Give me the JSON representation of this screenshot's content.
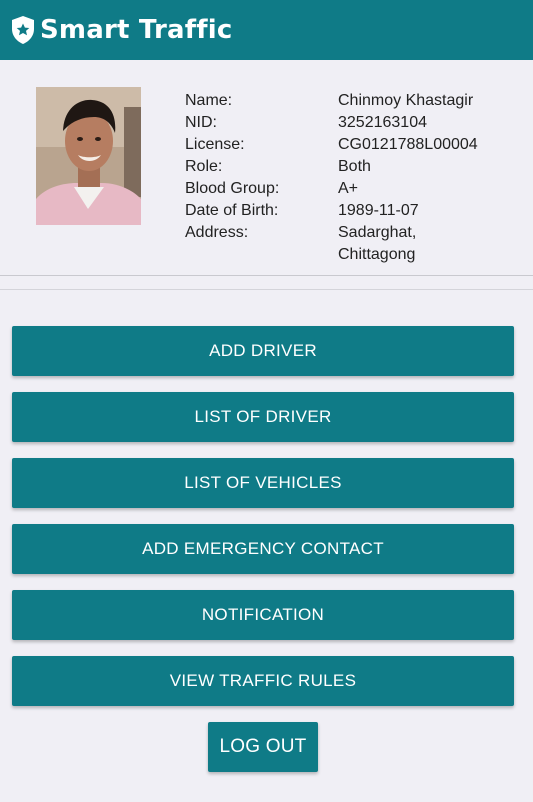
{
  "app": {
    "title": "Smart Traffic",
    "logo_icon": "shield-star-icon",
    "accent_color": "#0f7b87"
  },
  "profile": {
    "photo_icon": "user-photo",
    "fields": [
      {
        "label": "Name:",
        "value": "Chinmoy Khastagir"
      },
      {
        "label": "NID:",
        "value": "3252163104"
      },
      {
        "label": "License:",
        "value": "CG0121788L00004"
      },
      {
        "label": "Role:",
        "value": "Both"
      },
      {
        "label": "Blood Group:",
        "value": "A+"
      },
      {
        "label": "Date of Birth:",
        "value": "1989-11-07"
      },
      {
        "label": "Address:",
        "value": "Sadarghat,",
        "value2": "Chittagong"
      }
    ]
  },
  "menu": {
    "add_driver": "ADD DRIVER",
    "list_driver": "LIST OF DRIVER",
    "list_vehicles": "LIST OF VEHICLES",
    "add_emergency": "ADD EMERGENCY CONTACT",
    "notification": "NOTIFICATION",
    "traffic_rules": "VIEW TRAFFIC RULES",
    "logout": "LOG OUT"
  }
}
